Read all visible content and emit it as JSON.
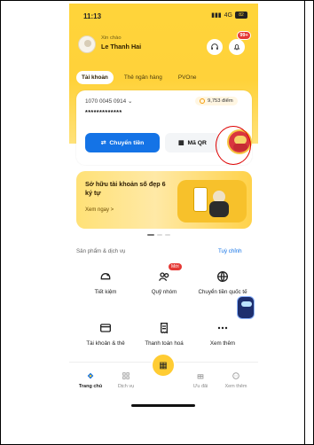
{
  "status": {
    "time": "11:13",
    "network": "4G",
    "battery": "82"
  },
  "header": {
    "greeting": "Xin chào",
    "user_name": "Le Thanh Hai",
    "notification_badge": "99+"
  },
  "tabs": [
    {
      "label": "Tài khoản",
      "active": true
    },
    {
      "label": "Thẻ ngân hàng",
      "active": false
    },
    {
      "label": "PVOne",
      "active": false
    }
  ],
  "account": {
    "number": "1070 0045 0914",
    "masked_balance": "*************",
    "points": "9,753 điểm",
    "transfer_label": "Chuyển tiền",
    "qr_label": "Mã QR"
  },
  "banner": {
    "title": "Sở hữu tài khoản số đẹp 6 ký tự",
    "link": "Xem ngay >"
  },
  "products": {
    "title": "Sản phẩm & dịch vụ",
    "customize": "Tuỳ chỉnh",
    "items": [
      {
        "label": "Tiết kiệm",
        "icon": "savings-icon"
      },
      {
        "label": "Quỹ nhóm",
        "icon": "group-fund-icon",
        "badge": "Mới"
      },
      {
        "label": "Chuyển tiền quốc tế",
        "icon": "globe-icon"
      },
      {
        "label": "Tài khoản & thẻ",
        "icon": "card-icon"
      },
      {
        "label": "Thanh toán hoá",
        "icon": "bill-icon"
      },
      {
        "label": "Xem thêm",
        "icon": "more-icon"
      }
    ]
  },
  "bottom_nav": [
    {
      "label": "Trang chủ",
      "active": true
    },
    {
      "label": "Dịch vụ",
      "active": false
    },
    {
      "label": "Ưu đãi",
      "active": false
    },
    {
      "label": "Xem thêm",
      "active": false
    }
  ],
  "colors": {
    "brand_yellow": "#ffd43a",
    "primary_blue": "#1473e6",
    "alert_red": "#e53935"
  }
}
